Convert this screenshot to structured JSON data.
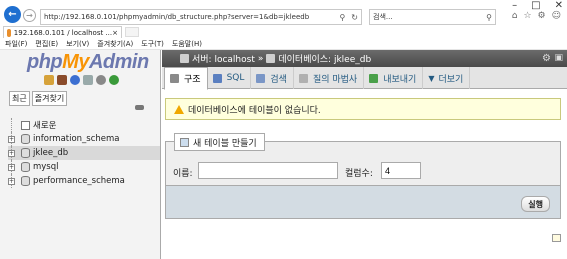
{
  "browser": {
    "url": "http://192.168.0.101/phpmyadmin/db_structure.php?server=1&db=jkleedb",
    "search_label": "검색...",
    "tab_title": "192.168.0.101 / localhost ...",
    "menu": [
      "파일(F)",
      "편집(E)",
      "보기(V)",
      "즐겨찾기(A)",
      "도구(T)",
      "도움말(H)"
    ]
  },
  "sidebar": {
    "logo": {
      "php": "php",
      "my": "My",
      "admin": "Admin"
    },
    "tabs": [
      "최근",
      "즐겨찾기"
    ],
    "tree": [
      {
        "label": "새로운",
        "kind": "new"
      },
      {
        "label": "information_schema",
        "kind": "db"
      },
      {
        "label": "jklee_db",
        "kind": "db",
        "active": true
      },
      {
        "label": "mysql",
        "kind": "db"
      },
      {
        "label": "performance_schema",
        "kind": "db"
      }
    ]
  },
  "breadcrumb": {
    "server": "서버: localhost",
    "database": "데이터베이스: jklee_db"
  },
  "db_tabs": [
    {
      "label": "구조",
      "icon": "structure-icon",
      "color": "#8a8a8a"
    },
    {
      "label": "SQL",
      "icon": "sql-icon",
      "color": "#5a7fc0"
    },
    {
      "label": "검색",
      "icon": "search-icon",
      "color": "#7a96c6"
    },
    {
      "label": "질의 마법사",
      "icon": "query-icon",
      "color": "#b0b0b0"
    },
    {
      "label": "내보내기",
      "icon": "export-icon",
      "color": "#4aa04a"
    },
    {
      "label": "더보기",
      "icon": "chevron-down-icon",
      "color": "#333333"
    }
  ],
  "notice": "데이터베이스에 테이블이 없습니다.",
  "create_table": {
    "legend": "새 테이블 만들기",
    "name_label": "이름:",
    "name_value": "",
    "columns_label": "컬럼수:",
    "columns_value": "4",
    "go_label": "실행"
  }
}
